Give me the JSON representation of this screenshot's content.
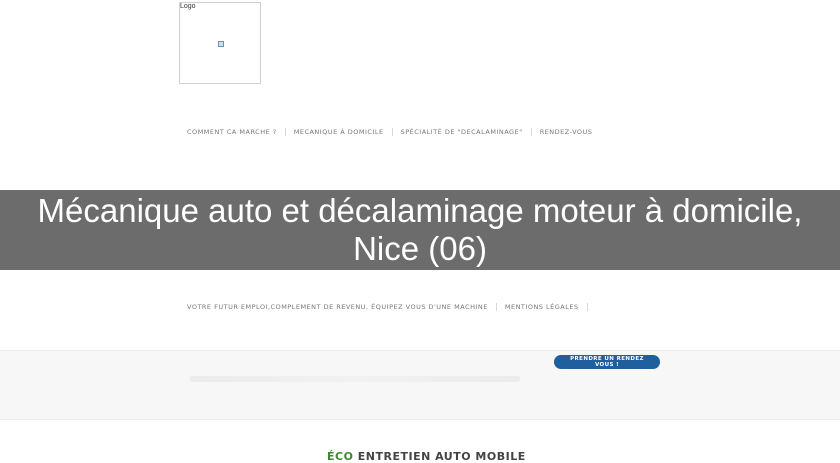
{
  "logo": {
    "label": "Logo"
  },
  "nav_primary": [
    {
      "label": "COMMENT CA MARCHE ?"
    },
    {
      "label": "MECANIQUE À DOMICILE"
    },
    {
      "label": "SPÉCIALITÉ DE \"DECALAMINAGE\""
    },
    {
      "label": "RENDEZ-VOUS"
    }
  ],
  "banner": {
    "title": "Mécanique auto et décalaminage moteur à domicile, Nice (06)"
  },
  "nav_secondary": [
    {
      "label": "VOTRE FUTUR EMPLOI,COMPLEMENT DE REVENU, ÉQUIPEZ VOUS D'UNE MACHINE"
    },
    {
      "label": "MENTIONS LÉGALES"
    }
  ],
  "cta": {
    "label": "PRENDRE UN RENDEZ VOUS !"
  },
  "brand": {
    "eco": "ÉCO",
    "rest": " ENTRETIEN AUTO MOBILE"
  },
  "colors": {
    "cta": "#1f5f9e",
    "banner": "#5f5f5f",
    "brand_eco": "#3a8a2e"
  }
}
